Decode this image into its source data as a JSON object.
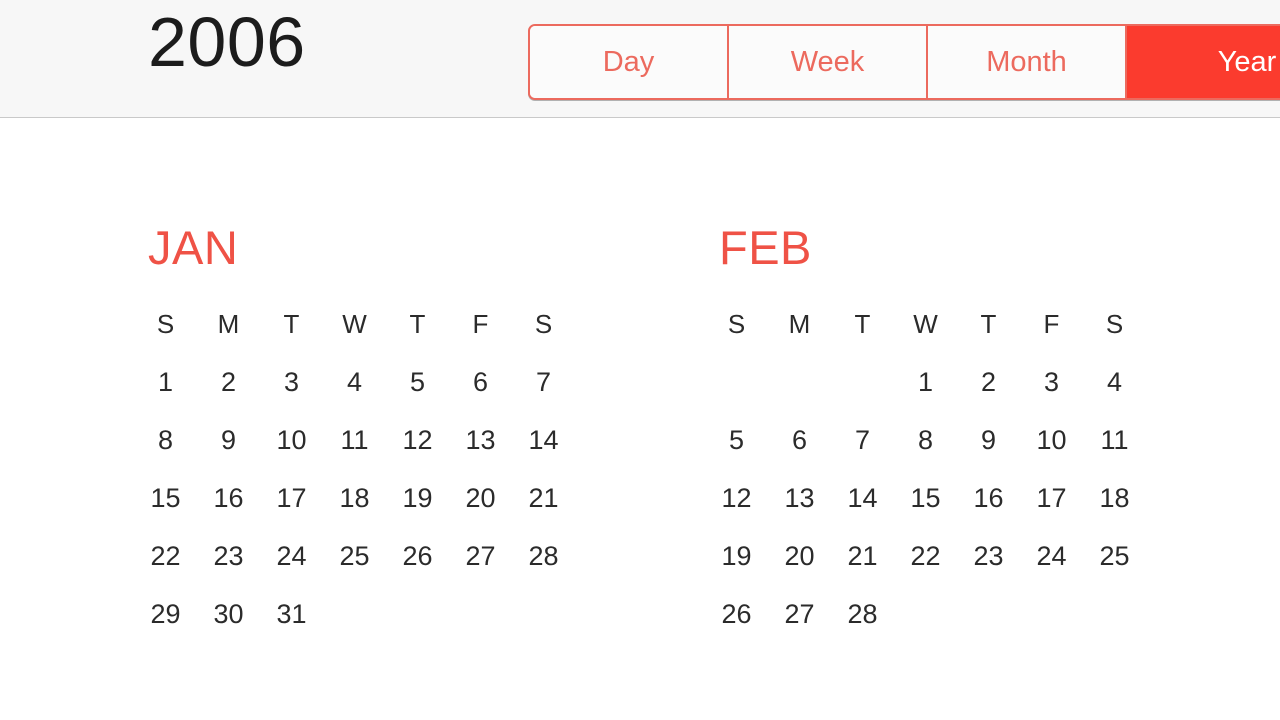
{
  "header": {
    "year_title": "2006",
    "view_tabs": [
      {
        "label": "Day",
        "selected": false
      },
      {
        "label": "Week",
        "selected": false
      },
      {
        "label": "Month",
        "selected": false
      },
      {
        "label": "Year",
        "selected": true
      }
    ]
  },
  "colors": {
    "accent_red": "#FB3B2E",
    "accent_red_muted": "#EC6A5E",
    "month_label_red": "#EF5246",
    "header_background": "#F7F7F7",
    "header_border": "#C9C9C9",
    "date_text": "#2B2B2B",
    "page_background": "#FFFFFF"
  },
  "calendar": {
    "year": "2006",
    "weekday_initials": [
      "S",
      "M",
      "T",
      "W",
      "T",
      "F",
      "S"
    ],
    "months": [
      {
        "name": "JAN",
        "weeks": [
          [
            "1",
            "2",
            "3",
            "4",
            "5",
            "6",
            "7"
          ],
          [
            "8",
            "9",
            "10",
            "11",
            "12",
            "13",
            "14"
          ],
          [
            "15",
            "16",
            "17",
            "18",
            "19",
            "20",
            "21"
          ],
          [
            "22",
            "23",
            "24",
            "25",
            "26",
            "27",
            "28"
          ],
          [
            "29",
            "30",
            "31",
            "",
            "",
            "",
            ""
          ]
        ]
      },
      {
        "name": "FEB",
        "weeks": [
          [
            "",
            "",
            "",
            "1",
            "2",
            "3",
            "4"
          ],
          [
            "5",
            "6",
            "7",
            "8",
            "9",
            "10",
            "11"
          ],
          [
            "12",
            "13",
            "14",
            "15",
            "16",
            "17",
            "18"
          ],
          [
            "19",
            "20",
            "21",
            "22",
            "23",
            "24",
            "25"
          ],
          [
            "26",
            "27",
            "28",
            "",
            "",
            "",
            ""
          ]
        ]
      }
    ]
  }
}
